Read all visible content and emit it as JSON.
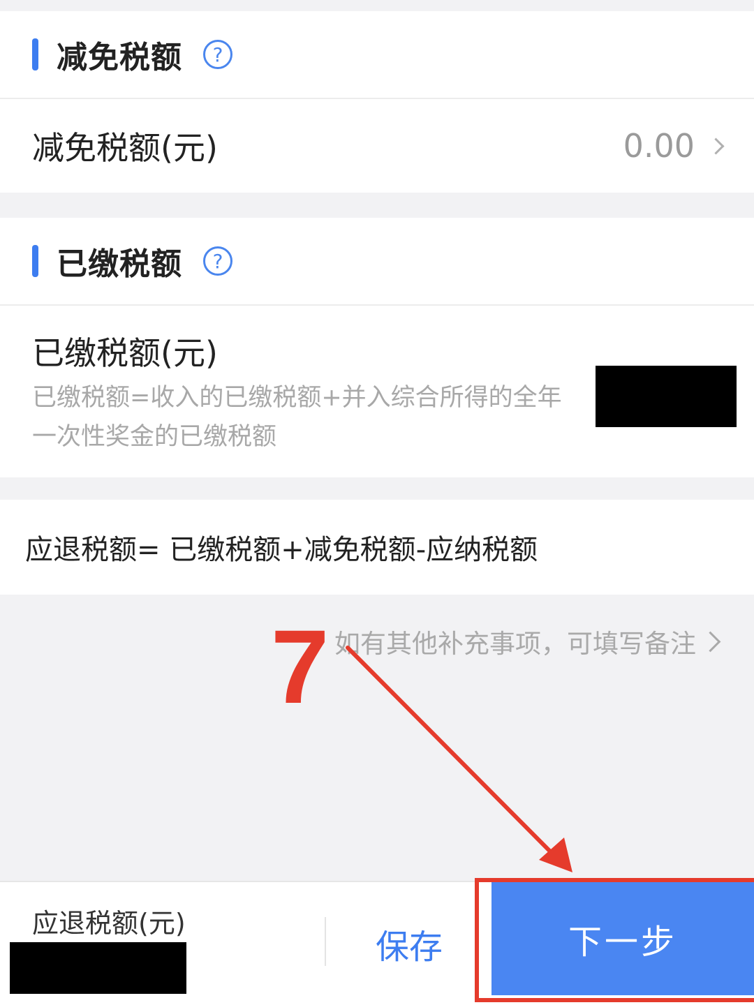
{
  "relief_section": {
    "title": "减免税额",
    "help_icon": "question-circle-icon",
    "row_label": "减免税额(元)",
    "row_value": "0.00"
  },
  "paid_section": {
    "title": "已缴税额",
    "help_icon": "question-circle-icon",
    "row_label": "已缴税额(元)",
    "description": "已缴税额=收入的已缴税额+并入综合所得的全年\n一次性奖金的已缴税额"
  },
  "formula": "应退税额= 已缴税额+减免税额-应纳税额",
  "note_link": "如有其他补充事项，可填写备注",
  "annotation": {
    "step_number": "7",
    "color": "#e53b2c"
  },
  "bottom_bar": {
    "refund_label": "应退税额(元)",
    "save_label": "保存",
    "next_label": "下一步"
  },
  "colors": {
    "accent": "#4a86f2",
    "background": "#f2f2f4"
  }
}
